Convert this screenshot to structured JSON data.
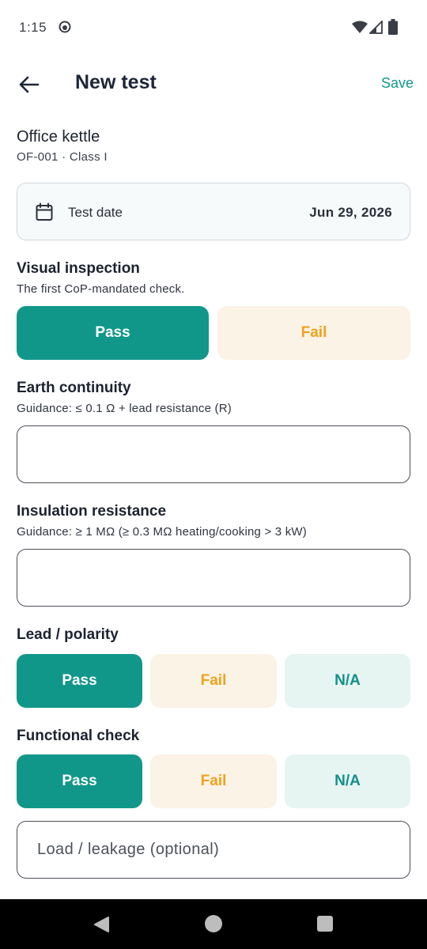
{
  "status_bar": {
    "time": "1:15"
  },
  "app_bar": {
    "title": "New test",
    "save_label": "Save"
  },
  "device": {
    "name": "Office kettle",
    "meta": "OF-001 · Class I"
  },
  "test_date": {
    "label": "Test date",
    "value": "Jun 29, 2026"
  },
  "visual_inspection": {
    "title": "Visual inspection",
    "hint": "The first CoP-mandated check.",
    "options": {
      "pass": "Pass",
      "fail": "Fail"
    },
    "selected": "Pass"
  },
  "earth_continuity": {
    "title": "Earth continuity",
    "hint": "Guidance: ≤ 0.1 Ω + lead resistance (R)",
    "value": ""
  },
  "insulation_resistance": {
    "title": "Insulation resistance",
    "hint": "Guidance: ≥ 1 MΩ  (≥ 0.3 MΩ heating/cooking > 3 kW)",
    "value": ""
  },
  "lead_polarity": {
    "title": "Lead / polarity",
    "options": {
      "pass": "Pass",
      "fail": "Fail",
      "na": "N/A"
    },
    "selected": "Pass"
  },
  "functional_check": {
    "title": "Functional check",
    "options": {
      "pass": "Pass",
      "fail": "Fail",
      "na": "N/A"
    },
    "selected": "Pass"
  },
  "load_leakage": {
    "placeholder": "Load / leakage (optional)",
    "value": ""
  },
  "colors": {
    "accent": "#11978a",
    "fail_text": "#f0a21c",
    "fail_bg": "#faf3e6",
    "na_bg": "#e6f4f2"
  }
}
